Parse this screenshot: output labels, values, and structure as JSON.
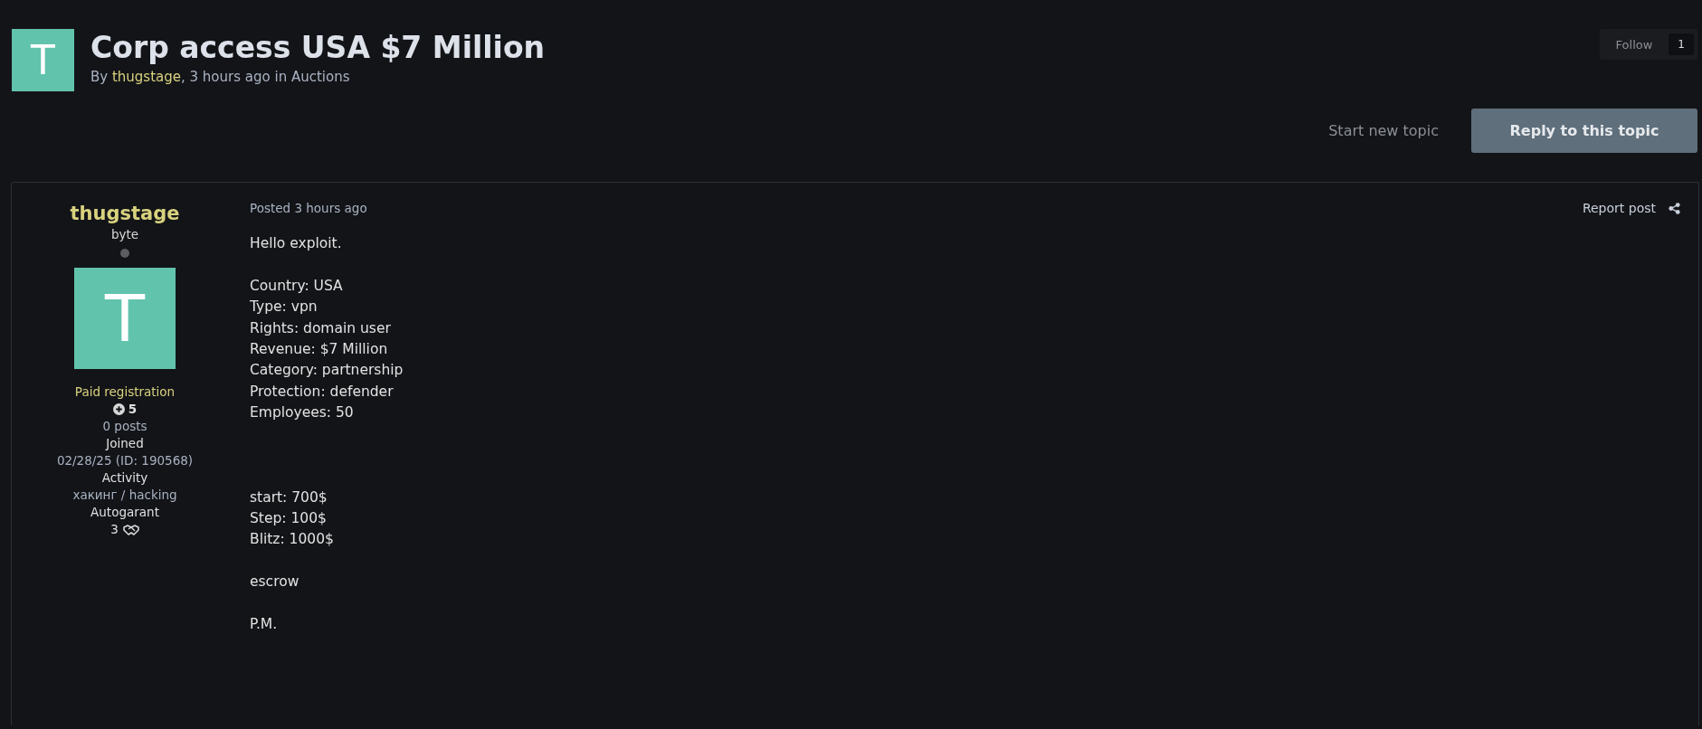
{
  "topic": {
    "avatar_letter": "T",
    "title": "Corp access USA $7 Million",
    "by": "By",
    "author": "thugstage",
    "time": ", 3 hours ago in",
    "forum": "Auctions"
  },
  "follow": {
    "label": "Follow",
    "count": "1"
  },
  "actions": {
    "start": "Start new topic",
    "reply": "Reply to this topic"
  },
  "post": {
    "author": {
      "name": "thugstage",
      "rank": "byte",
      "online": false,
      "avatar_letter": "T",
      "group": "Paid registration",
      "reputation": "5",
      "posts": "0 posts",
      "joined_label": "Joined",
      "joined": "02/28/25 (ID: 190568)",
      "activity_label": "Activity",
      "activity": "хакинг / hacking",
      "guarantee_label": "Autogarant",
      "guarantee": "3"
    },
    "posted": "Posted 3 hours ago",
    "report": "Report post",
    "paragraphs": [
      [
        "Hello exploit."
      ],
      [
        "Country: USA",
        "Type: vpn",
        "Rights: domain user",
        "Revenue: $7 Million",
        "Category: partnership",
        "Protection: defender",
        "Employees: 50"
      ],
      [
        "start: 700$",
        "Step: 100$",
        "Blitz: 1000$"
      ],
      [
        "escrow"
      ],
      [
        "P.M."
      ]
    ]
  }
}
